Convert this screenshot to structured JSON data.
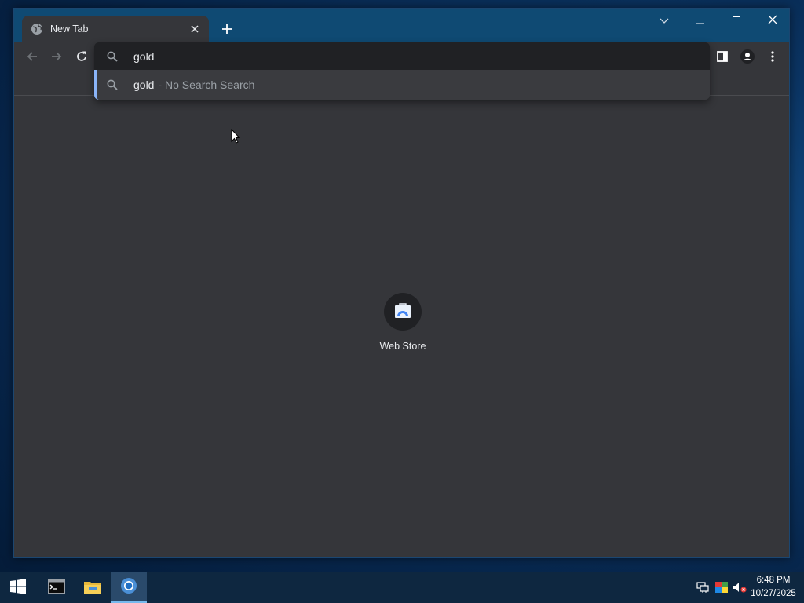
{
  "browser": {
    "tab": {
      "title": "New Tab"
    },
    "omnibox": {
      "value": "gold",
      "suggestion": {
        "term": "gold",
        "description": "- No Search Search"
      }
    },
    "shortcuts": [
      {
        "label": "Web Store"
      }
    ]
  },
  "taskbar": {
    "clock": {
      "time": "6:48 PM",
      "date": "10/27/2025"
    }
  },
  "colors": {
    "tabstrip": "#0f4a73",
    "window_bg": "#35363a",
    "omnibox_input": "#202124",
    "suggestion_accent": "#8ab4f8",
    "taskbar": "#0e2740"
  },
  "icons": [
    "globe-icon",
    "close-icon",
    "plus-icon",
    "chevron-down-icon",
    "minimize-icon",
    "maximize-icon",
    "back-arrow-icon",
    "forward-arrow-icon",
    "reload-icon",
    "search-icon",
    "side-panel-icon",
    "profile-icon",
    "more-vert-icon",
    "web-store-icon",
    "windows-start-icon",
    "terminal-icon",
    "file-explorer-icon",
    "chromium-icon",
    "network-icon",
    "color-icon",
    "volume-muted-icon",
    "mouse-cursor-icon"
  ]
}
